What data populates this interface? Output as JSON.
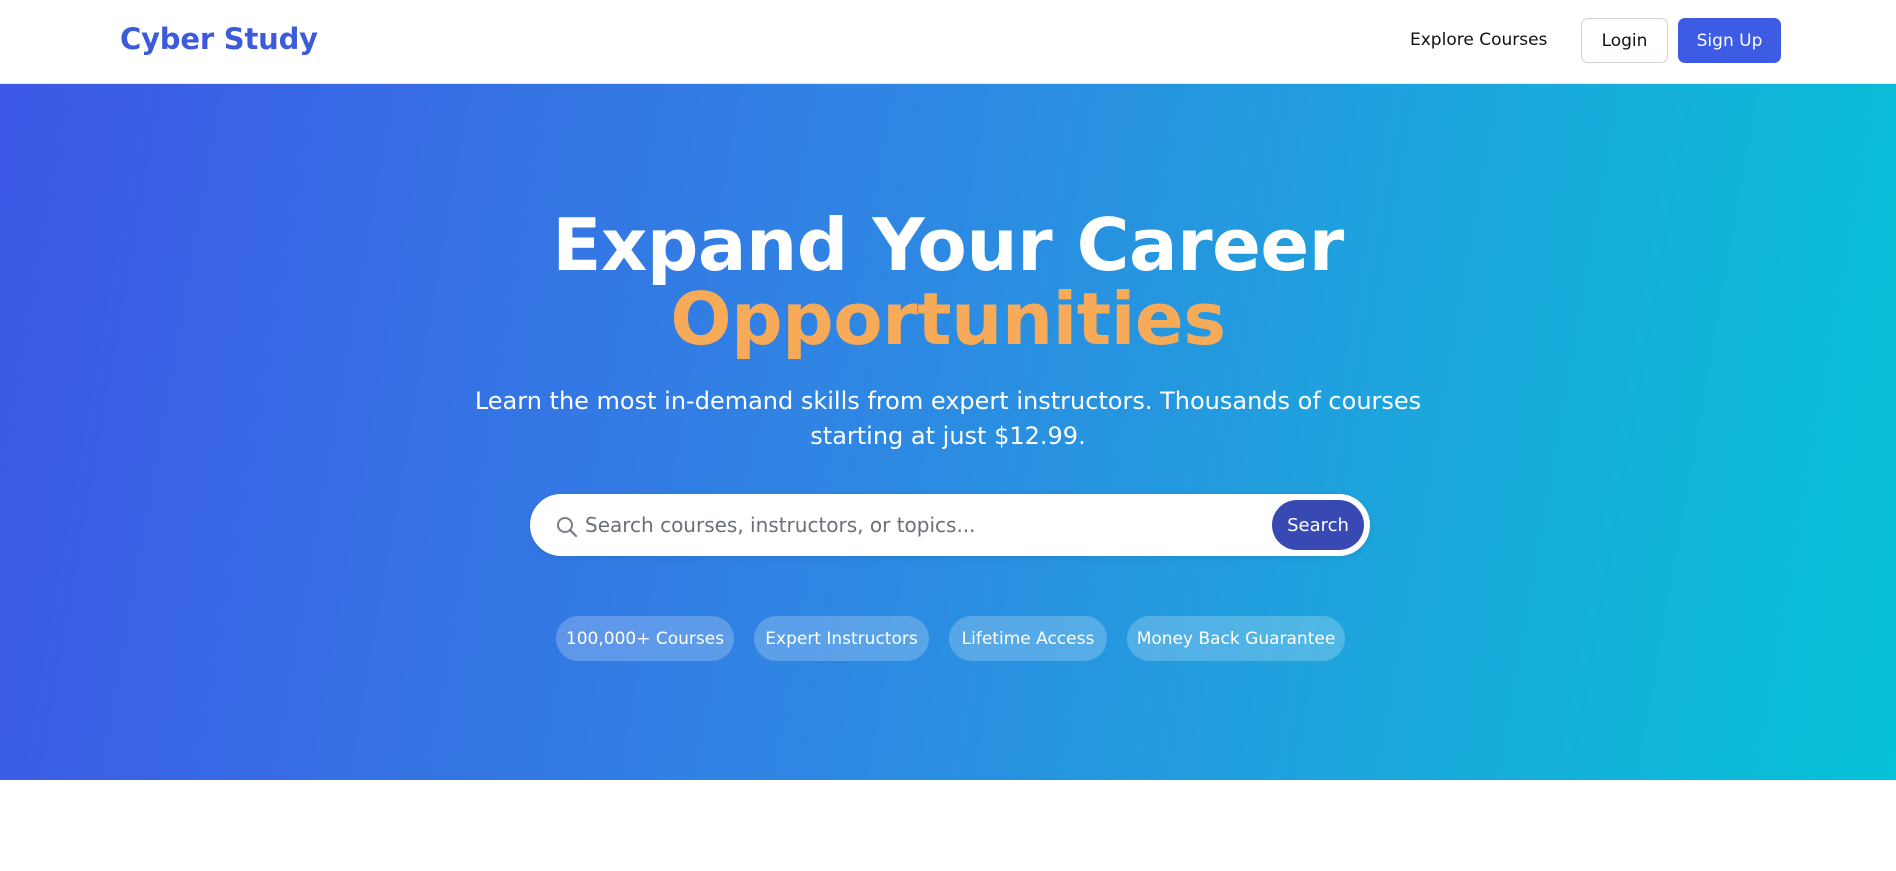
{
  "navbar": {
    "brand": "Cyber Study",
    "explore_label": "Explore Courses",
    "login_label": "Login",
    "signup_label": "Sign Up"
  },
  "hero": {
    "headline": "Expand Your Career",
    "headline_accent": "Opportunities",
    "subtext": "Learn the most in-demand skills from expert instructors. Thousands of courses starting at just $12.99.",
    "search": {
      "placeholder": "Search courses, instructors, or topics...",
      "value": "",
      "button_label": "Search",
      "icon": "search-icon"
    },
    "features": [
      "100,000+ Courses",
      "Expert Instructors",
      "Lifetime Access",
      "Money Back Guarantee"
    ]
  },
  "colors": {
    "brand": "#3b5bdb",
    "signup_button": "#3d5be3",
    "search_button": "#3949b3",
    "accent_text": "#f7ab59",
    "gradient_start": "#3d57e6",
    "gradient_end": "#05c2d6"
  }
}
